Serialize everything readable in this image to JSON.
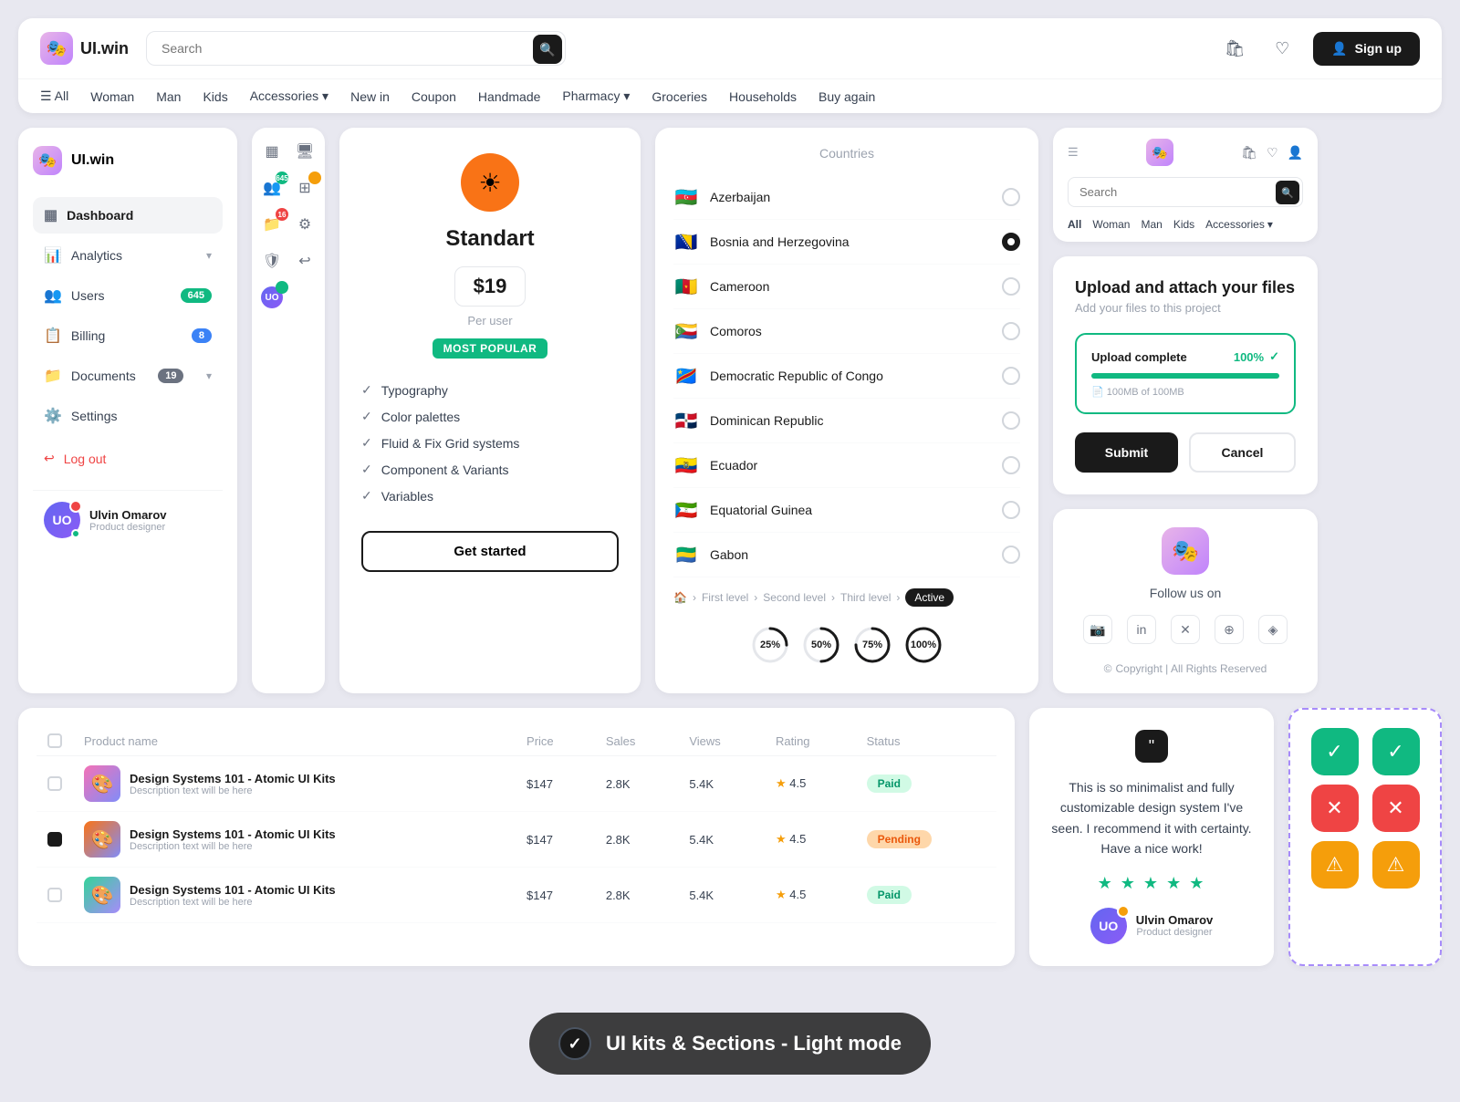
{
  "brand": {
    "name": "UI.win",
    "emoji": "🎭"
  },
  "navbar": {
    "search_placeholder": "Search",
    "signup_label": "Sign up",
    "links": [
      "All",
      "Woman",
      "Man",
      "Kids",
      "Accessories ▾",
      "New in",
      "Coupon",
      "Handmade",
      "Pharmacy ▾",
      "Groceries",
      "Households",
      "Buy again"
    ]
  },
  "mini_navbar": {
    "search_placeholder": "Search",
    "links": [
      "All",
      "Woman",
      "Man",
      "Kids",
      "Accessories ▾"
    ]
  },
  "sidebar": {
    "logo": "UI.win",
    "items": [
      {
        "label": "Dashboard",
        "icon": "▦",
        "badge": null
      },
      {
        "label": "Analytics",
        "icon": "📊",
        "badge": null,
        "chevron": true
      },
      {
        "label": "Users",
        "icon": "👥",
        "badge": "645"
      },
      {
        "label": "Billing",
        "icon": "📋",
        "badge": "8",
        "badge_color": "blue"
      },
      {
        "label": "Documents",
        "icon": "📁",
        "badge": "19",
        "chevron": true
      },
      {
        "label": "Settings",
        "icon": "⚙️",
        "badge": null
      }
    ],
    "logout": "Log out",
    "user_name": "Ulvin Omarov",
    "user_role": "Product designer",
    "user_initials": "UO"
  },
  "pricing": {
    "title": "Standart",
    "price": "$19",
    "per": "Per user",
    "popular_label": "MOST POPULAR",
    "features": [
      "Typography",
      "Color palettes",
      "Fluid & Fix Grid systems",
      "Component & Variants",
      "Variables"
    ],
    "cta": "Get started"
  },
  "countries": {
    "title": "Countries",
    "list": [
      {
        "name": "Azerbaijan",
        "flag": "🇦🇿",
        "selected": false
      },
      {
        "name": "Bosnia and Herzegovina",
        "flag": "🇧🇦",
        "selected": true
      },
      {
        "name": "Cameroon",
        "flag": "🇨🇲",
        "selected": false
      },
      {
        "name": "Comoros",
        "flag": "🇰🇲",
        "selected": false
      },
      {
        "name": "Democratic Republic of Congo",
        "flag": "🇨🇩",
        "selected": false
      },
      {
        "name": "Dominican Republic",
        "flag": "🇩🇴",
        "selected": false
      },
      {
        "name": "Ecuador",
        "flag": "🇪🇨",
        "selected": false
      },
      {
        "name": "Equatorial Guinea",
        "flag": "🇬🇶",
        "selected": false
      },
      {
        "name": "Gabon",
        "flag": "🇬🇦",
        "selected": false
      }
    ],
    "breadcrumb": [
      "🏠",
      "First level",
      "Second level",
      "Third level",
      "Active"
    ],
    "progress": [
      {
        "pct": 25,
        "label": "25%"
      },
      {
        "pct": 50,
        "label": "50%"
      },
      {
        "pct": 75,
        "label": "75%"
      },
      {
        "pct": 100,
        "label": "100%"
      }
    ]
  },
  "upload": {
    "title": "Upload and attach your files",
    "subtitle": "Add your files to this project",
    "progress_label": "Upload complete",
    "percent": "100%",
    "file_info": "100MB of 100MB",
    "submit": "Submit",
    "cancel": "Cancel"
  },
  "follow": {
    "title": "Follow us on",
    "copyright": "Copyright | All Rights Reserved",
    "social": [
      "instagram",
      "linkedin",
      "twitter-x",
      "dribbble",
      "figma"
    ]
  },
  "table": {
    "header_checkbox": "",
    "columns": [
      "Product name",
      "Price",
      "Sales",
      "Views",
      "Rating",
      "Status"
    ],
    "rows": [
      {
        "id": 1,
        "checked": false,
        "name": "Design Systems 101 - Atomic UI Kits",
        "desc": "Description text will be here",
        "price": "$147",
        "sales": "2.8K",
        "views": "5.4K",
        "rating": "4.5",
        "status": "Paid",
        "status_color": "paid",
        "thumb_bg": "#f3a3e0"
      },
      {
        "id": 2,
        "checked": true,
        "name": "Design Systems 101 - Atomic UI Kits",
        "desc": "Description text will be here",
        "price": "$147",
        "sales": "2.8K",
        "views": "5.4K",
        "rating": "4.5",
        "status": "Pending",
        "status_color": "pending",
        "thumb_bg": "#818cf8"
      },
      {
        "id": 3,
        "checked": false,
        "name": "Design Systems 101 - Atomic UI Kits",
        "desc": "Description text will be here",
        "price": "$147",
        "sales": "2.8K",
        "views": "5.4K",
        "rating": "4.5",
        "status": "Paid",
        "status_color": "paid",
        "thumb_bg": "#34d399"
      }
    ]
  },
  "testimonial": {
    "text": "This is so minimalist and fully customizable design system I've seen. I recommend it with certainty. Have a nice work!",
    "stars": 5,
    "user_name": "Ulvin Omarov",
    "user_role": "Product designer",
    "user_initials": "UO"
  },
  "icon_buttons": {
    "rows": [
      [
        {
          "type": "check",
          "color": "green",
          "symbol": "✓"
        },
        {
          "type": "check",
          "color": "green",
          "symbol": "✓"
        }
      ],
      [
        {
          "type": "close",
          "color": "red",
          "symbol": "✕"
        },
        {
          "type": "close",
          "color": "red",
          "symbol": "✕"
        }
      ],
      [
        {
          "type": "warning",
          "color": "yellow",
          "symbol": "⚠"
        },
        {
          "type": "warning",
          "color": "yellow",
          "symbol": "⚠"
        }
      ]
    ]
  },
  "banner": {
    "text": "UI kits & Sections - Light mode"
  }
}
